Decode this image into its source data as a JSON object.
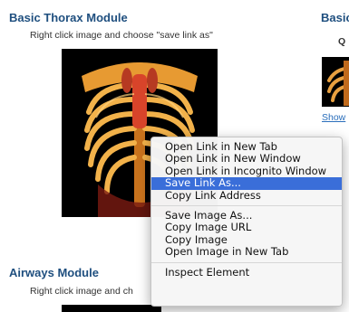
{
  "left_column": {
    "thorax": {
      "title": "Basic Thorax Module",
      "instruction": "Right click image and choose \"save link as\""
    },
    "airways": {
      "title": "Airways Module",
      "instruction": "Right click image and ch"
    }
  },
  "right_column": {
    "title_partial": "Basic",
    "label_partial": "Q",
    "show_link": "Show"
  },
  "context_menu": {
    "items": [
      "Open Link in New Tab",
      "Open Link in New Window",
      "Open Link in Incognito Window",
      "Save Link As...",
      "Copy Link Address",
      "Save Image As...",
      "Copy Image URL",
      "Copy Image",
      "Open Image in New Tab",
      "Inspect Element"
    ],
    "selected": "Save Link As..."
  },
  "colors": {
    "heading": "#1f4f7f",
    "link": "#2a6ebb",
    "menu_highlight": "#3a6ed9"
  }
}
